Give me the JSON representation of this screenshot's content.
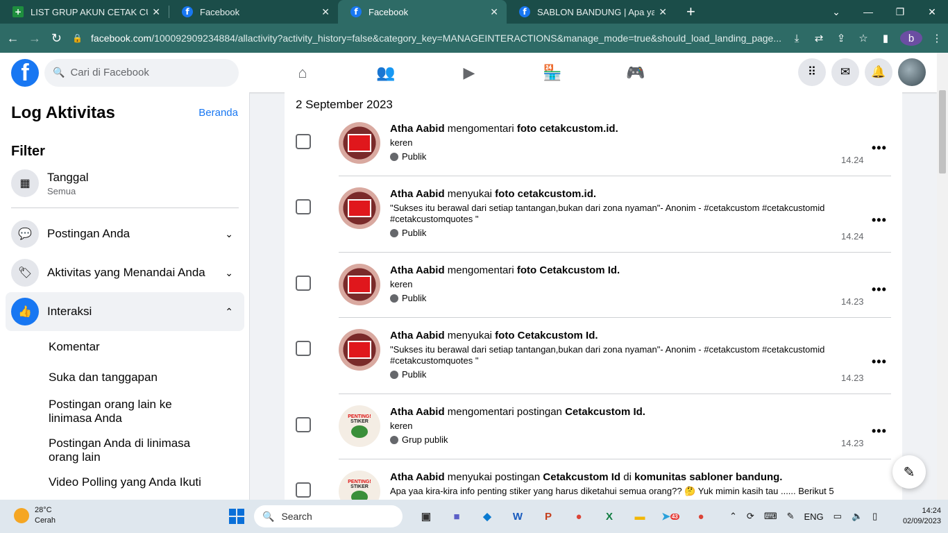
{
  "browser": {
    "tabs": [
      {
        "title": "LIST GRUP AKUN CETAK CUSTOM",
        "icon": "sheets-icon",
        "active": false
      },
      {
        "title": "Facebook",
        "icon": "facebook-icon",
        "active": false
      },
      {
        "title": "Facebook",
        "icon": "facebook-icon",
        "active": true
      },
      {
        "title": "SABLON BANDUNG | Apa yaa kira",
        "icon": "facebook-icon",
        "active": false
      }
    ],
    "url_host": "facebook.com",
    "url_rest": "/100092909234884/allactivity?activity_history=false&category_key=MANAGEINTERACTIONS&manage_mode=true&should_load_landing_page...",
    "profile_initial": "b"
  },
  "fb_header": {
    "search_placeholder": "Cari di Facebook"
  },
  "sidebar": {
    "title": "Log Aktivitas",
    "home_link": "Beranda",
    "filter_title": "Filter",
    "date_filter": {
      "label": "Tanggal",
      "value": "Semua"
    },
    "sections": [
      {
        "label": "Postingan Anda",
        "expanded": false
      },
      {
        "label": "Aktivitas yang Menandai Anda",
        "expanded": false
      },
      {
        "label": "Interaksi",
        "expanded": true
      }
    ],
    "sub_items": [
      "Komentar",
      "Suka dan tanggapan",
      "Postingan orang lain ke linimasa Anda",
      "Postingan Anda di linimasa orang lain",
      "Video Polling yang Anda Ikuti"
    ]
  },
  "main": {
    "date_header": "2 September 2023",
    "entries": [
      {
        "actor": "Atha Aabid",
        "verb": "mengomentari",
        "obj": "foto",
        "target": "cetakcustom.id.",
        "extra": "",
        "group": "",
        "text": "keren",
        "audience": "Publik",
        "time": "14.24"
      },
      {
        "actor": "Atha Aabid",
        "verb": "menyukai",
        "obj": "foto",
        "target": "cetakcustom.id.",
        "extra": "",
        "group": "",
        "text": "\"Sukses itu berawal dari setiap tantangan,bukan dari zona nyaman\"- Anonim - #cetakcustom #cetakcustomid #cetakcustomquotes \"",
        "audience": "Publik",
        "time": "14.24"
      },
      {
        "actor": "Atha Aabid",
        "verb": "mengomentari",
        "obj": "foto",
        "target": "Cetakcustom Id.",
        "extra": "",
        "group": "",
        "text": "keren",
        "audience": "Publik",
        "time": "14.23"
      },
      {
        "actor": "Atha Aabid",
        "verb": "menyukai",
        "obj": "foto",
        "target": "Cetakcustom Id.",
        "extra": "",
        "group": "",
        "text": "\"Sukses itu berawal dari setiap tantangan,bukan dari zona nyaman\"- Anonim - #cetakcustom #cetakcustomid #cetakcustomquotes \"",
        "audience": "Publik",
        "time": "14.23"
      },
      {
        "actor": "Atha Aabid",
        "verb": "mengomentari postingan",
        "obj": "",
        "target": "Cetakcustom Id.",
        "extra": "",
        "group": "",
        "text": "keren",
        "audience": "Grup publik",
        "time": "14.23"
      },
      {
        "actor": "Atha Aabid",
        "verb": "menyukai postingan",
        "obj": "",
        "target": "Cetakcustom Id",
        "extra": "di",
        "group": "komunitas sabloner bandung.",
        "text": "Apa yaa kira-kira info penting stiker yang harus diketahui semua orang?? 🤔 Yuk mimin kasih tau ...... Berikut 5",
        "audience": "",
        "time": ""
      }
    ],
    "sticker_texts": [
      "PENTING!",
      "STIKER"
    ]
  },
  "taskbar": {
    "weather_temp": "28°C",
    "weather_desc": "Cerah",
    "search_label": "Search",
    "language": "ENG",
    "time": "14:24",
    "date": "02/09/2023",
    "badge_count": "43"
  },
  "colors": {
    "fb_blue": "#1877f2",
    "chrome_teal": "#2e6b66"
  }
}
